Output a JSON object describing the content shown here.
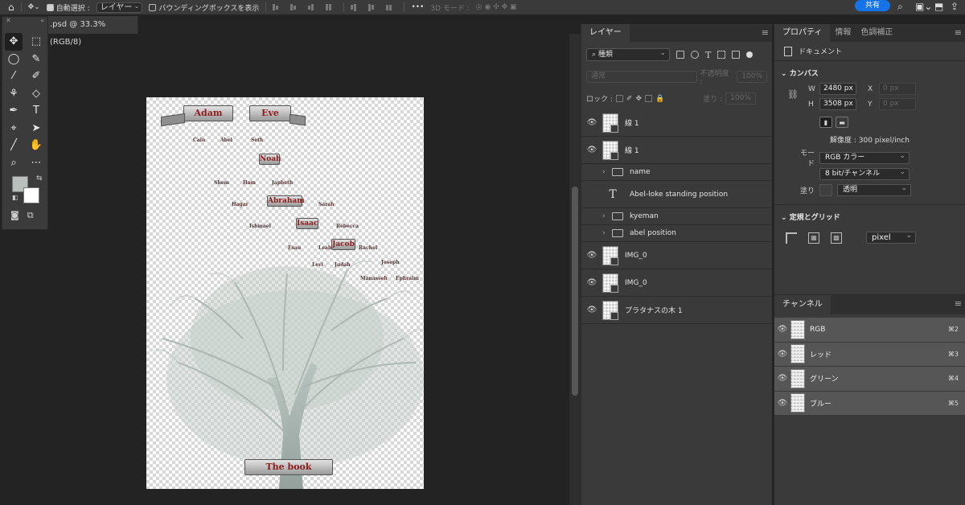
{
  "options_bar": {
    "auto_select_label": "自動選択 :",
    "auto_select_value": "レイヤー",
    "bounding_box_label": "バウンディングボックスを表示",
    "mode_3d_label": "3D モード :",
    "share_label": "共有"
  },
  "toolbox": {
    "tools": [
      {
        "name": "move-tool-icon",
        "glyph": "✥"
      },
      {
        "name": "marquee-tool-icon",
        "glyph": "⬚"
      },
      {
        "name": "lasso-tool-icon",
        "glyph": "◯"
      },
      {
        "name": "quick-select-tool-icon",
        "glyph": "✎"
      },
      {
        "name": "eyedropper-tool-icon",
        "glyph": "⁄"
      },
      {
        "name": "brush-tool-icon",
        "glyph": "✐"
      },
      {
        "name": "clone-stamp-tool-icon",
        "glyph": "⚘"
      },
      {
        "name": "eraser-tool-icon",
        "glyph": "◇"
      },
      {
        "name": "pen-tool-icon",
        "glyph": "✒"
      },
      {
        "name": "type-tool-icon",
        "glyph": "T"
      },
      {
        "name": "path-select-tool-icon",
        "glyph": "⌖"
      },
      {
        "name": "direct-select-tool-icon",
        "glyph": "➤"
      },
      {
        "name": "line-tool-icon",
        "glyph": "╱"
      },
      {
        "name": "hand-tool-icon",
        "glyph": "✋"
      },
      {
        "name": "zoom-tool-icon",
        "glyph": "⌕"
      },
      {
        "name": "more-tools-icon",
        "glyph": "⋯"
      }
    ],
    "foreground_color": "#b9bfbb",
    "background_color": "#ffffff"
  },
  "document": {
    "tab_title": ".psd @ 33.3% (RGB/8)"
  },
  "canvas": {
    "top_ribbons": [
      "Adam",
      "Eve"
    ],
    "bottom_ribbon": "The book",
    "names": [
      {
        "id": "noah",
        "text": "Noah"
      },
      {
        "id": "abraham",
        "text": "Abraham"
      },
      {
        "id": "isaac",
        "text": "Isaac"
      },
      {
        "id": "jacob",
        "text": "Jacob"
      }
    ],
    "small_names": [
      "Cain",
      "Abel",
      "Seth",
      "Shem",
      "Ham",
      "Japheth",
      "Hagar",
      "Sarah",
      "Ishmael",
      "Rebecca",
      "Esau",
      "Leah",
      "Rachel",
      "Levi",
      "Judah",
      "Joseph",
      "Manasseh",
      "Ephraim"
    ]
  },
  "layers_panel": {
    "tab_label": "レイヤー",
    "filter_kind": "種類",
    "blend_mode": "通常",
    "opacity_label": "不透明度 :",
    "opacity_value": "100%",
    "lock_label": "ロック :",
    "fill_label": "塗り :",
    "fill_value": "100%",
    "layers": [
      {
        "name": "線 1",
        "type": "pixel",
        "visible": true
      },
      {
        "name": "線 1",
        "type": "pixel",
        "visible": true
      },
      {
        "name": "name",
        "type": "group",
        "visible": false
      },
      {
        "name": "Abel-loke standing position",
        "type": "text",
        "visible": false
      },
      {
        "name": "kyeman",
        "type": "group",
        "visible": false
      },
      {
        "name": "abel position",
        "type": "group",
        "visible": false
      },
      {
        "name": "IMG_0",
        "type": "pixel",
        "visible": true
      },
      {
        "name": "IMG_0",
        "type": "pixel",
        "visible": true
      },
      {
        "name": "プラタナスの木 1",
        "type": "pixel",
        "visible": true
      }
    ]
  },
  "properties_panel": {
    "tabs": [
      "プロパティ",
      "情報",
      "色調補正"
    ],
    "doc_label": "ドキュメント",
    "canvas_section": "カンバス",
    "width_label": "W",
    "width_value": "2480 px",
    "height_label": "H",
    "height_value": "3508 px",
    "x_label": "X",
    "x_placeholder": "0 px",
    "y_label": "Y",
    "y_placeholder": "0 px",
    "resolution": "解像度 : 300 pixel/inch",
    "mode_label": "モード",
    "mode_value": "RGB カラー",
    "bit_value": "8 bit/チャンネル",
    "fill_label": "塗り",
    "fill_value": "透明",
    "guides_section": "定規とグリッド",
    "units_value": "pixel"
  },
  "channels_panel": {
    "tab_label": "チャンネル",
    "channels": [
      {
        "name": "RGB",
        "shortcut": "⌘2"
      },
      {
        "name": "レッド",
        "shortcut": "⌘3"
      },
      {
        "name": "グリーン",
        "shortcut": "⌘4"
      },
      {
        "name": "ブルー",
        "shortcut": "⌘5"
      }
    ]
  }
}
